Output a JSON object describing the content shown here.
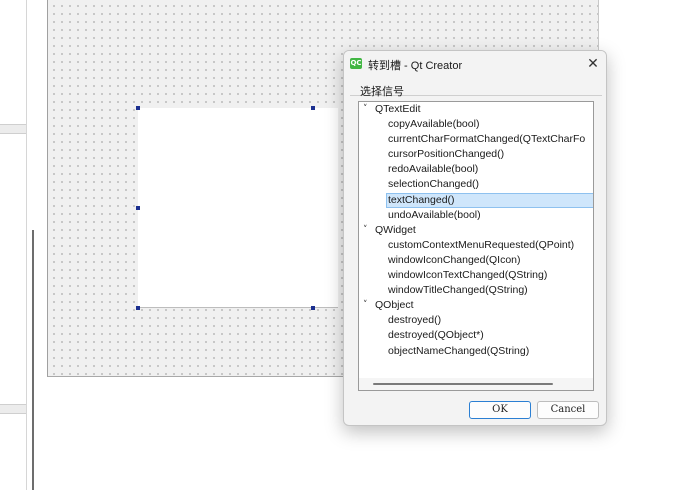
{
  "dialog": {
    "app_icon_text": "QC",
    "title": "转到槽 - Qt Creator",
    "close_glyph": "✕",
    "group_label": "选择信号",
    "ok_label": "OK",
    "cancel_label": "Cancel"
  },
  "signal_tree": {
    "expand_glyph": "˅",
    "groups": [
      {
        "name": "QTextEdit",
        "signals": [
          "copyAvailable(bool)",
          "currentCharFormatChanged(QTextCharFo",
          "cursorPositionChanged()",
          "redoAvailable(bool)",
          "selectionChanged()",
          "textChanged()",
          "undoAvailable(bool)"
        ]
      },
      {
        "name": "QWidget",
        "signals": [
          "customContextMenuRequested(QPoint)",
          "windowIconChanged(QIcon)",
          "windowIconTextChanged(QString)",
          "windowTitleChanged(QString)"
        ]
      },
      {
        "name": "QObject",
        "signals": [
          "destroyed()",
          "destroyed(QObject*)",
          "objectNameChanged(QString)"
        ]
      }
    ],
    "selected_signal": "textChanged()"
  },
  "colors": {
    "selection_bg": "#cfe6fb",
    "selection_border": "#8ec1ef",
    "handle": "#1b2f8f",
    "app_icon": "#41b643"
  }
}
